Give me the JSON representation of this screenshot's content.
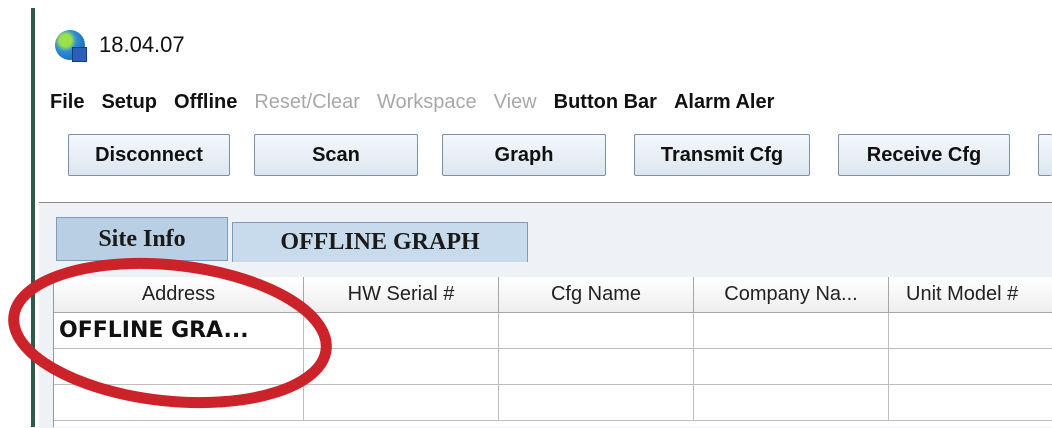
{
  "window": {
    "title": "18.04.07",
    "icon": "globe-computer-icon"
  },
  "menubar": {
    "items": [
      {
        "label": "File",
        "enabled": true
      },
      {
        "label": "Setup",
        "enabled": true
      },
      {
        "label": "Offline",
        "enabled": true
      },
      {
        "label": "Reset/Clear",
        "enabled": false
      },
      {
        "label": "Workspace",
        "enabled": false
      },
      {
        "label": "View",
        "enabled": false
      },
      {
        "label": "Button Bar",
        "enabled": true
      },
      {
        "label": "Alarm Aler",
        "enabled": true
      }
    ]
  },
  "toolbar": {
    "buttons": [
      "Disconnect",
      "Scan",
      "Graph",
      "Transmit Cfg",
      "Receive Cfg"
    ]
  },
  "tabs": [
    "Site Info",
    "OFFLINE GRAPH"
  ],
  "table": {
    "columns": [
      "Address",
      "HW Serial #",
      "Cfg Name",
      "Company Na...",
      "Unit Model #"
    ],
    "rows": [
      [
        "OFFLINE GRA...",
        "",
        "",
        "",
        ""
      ],
      [
        "",
        "",
        "",
        "",
        ""
      ],
      [
        "",
        "",
        "",
        "",
        ""
      ]
    ]
  },
  "annotation": {
    "color": "#cc2229"
  }
}
